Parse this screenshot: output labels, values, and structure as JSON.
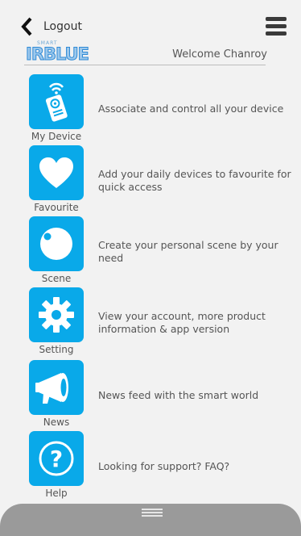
{
  "header": {
    "back_label": "Logout",
    "welcome_text": "Welcome Chanroy",
    "logo": {
      "small_text": "SMART",
      "big_text": "IRBLUE"
    }
  },
  "menu_items": [
    {
      "label": "My Device",
      "description": "Associate and control all your device",
      "icon": "remote-icon"
    },
    {
      "label": "Favourite",
      "description": "Add your daily devices to favourite for quick access",
      "icon": "heart-icon"
    },
    {
      "label": "Scene",
      "description": "Create your personal scene by your need",
      "icon": "scene-circle-icon"
    },
    {
      "label": "Setting",
      "description": "View your account, more product information & app version",
      "icon": "gear-icon"
    },
    {
      "label": "News",
      "description": "News feed with the smart world",
      "icon": "megaphone-icon"
    },
    {
      "label": "Help",
      "description": "Looking for support? FAQ?",
      "icon": "question-icon"
    }
  ],
  "colors": {
    "accent": "#09a9e9",
    "background": "#f2f2f2",
    "bottom_bar": "#9a9a9a"
  }
}
